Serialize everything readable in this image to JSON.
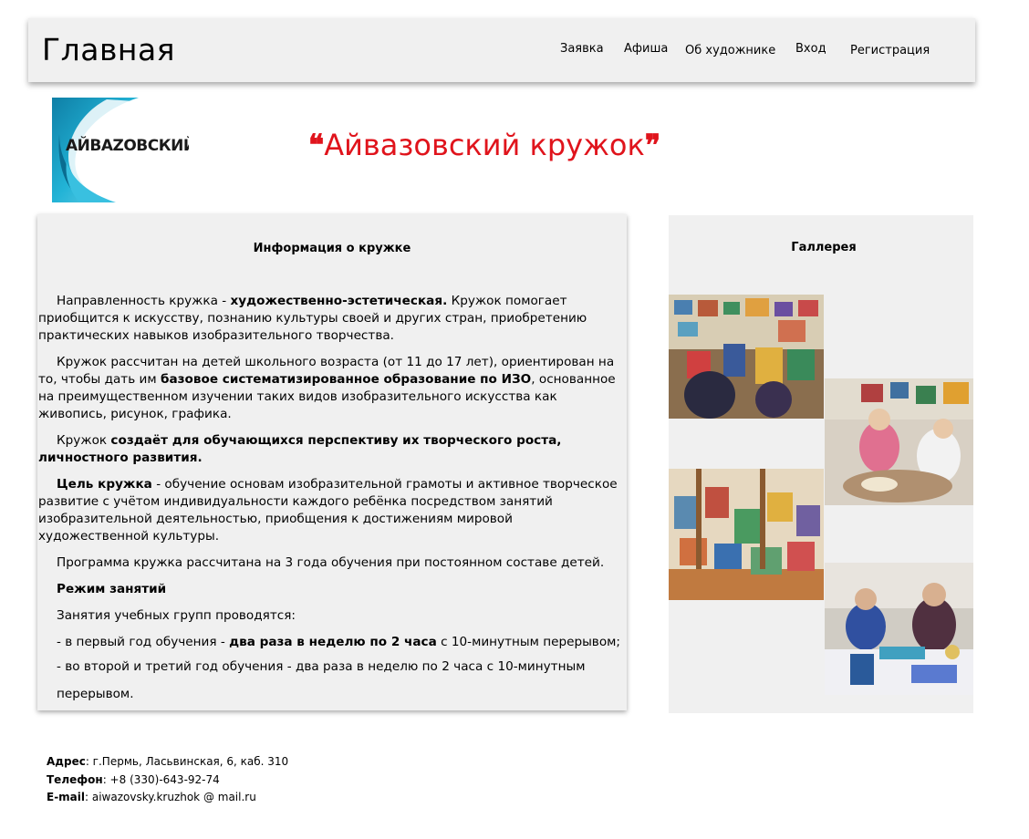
{
  "header": {
    "brand": "Главная",
    "nav": [
      "Заявка",
      "Афиша",
      "Об художнике",
      "Вход",
      "Регистрация"
    ]
  },
  "logo": {
    "text": "АЙВАZОВСКИЙ"
  },
  "title": {
    "open_quote": "❝",
    "text": "Айвазовский кружок",
    "close_quote": "❞"
  },
  "info": {
    "heading": "Информация о кружке",
    "p1": {
      "a": "Направленность кружка - ",
      "b": "художественно-эстетическая.",
      "c": " Кружок помогает приобщится к искусству, познанию культуры своей и других стран, приобретению практических навыков изобразительного творчества."
    },
    "p2": {
      "a": "Кружок рассчитан на детей школьного возраста (от 11 до 17 лет), ориентирован на то, чтобы дать им ",
      "b": "базовое систематизированное образование по ИЗО",
      "c": ", основанное на преимущественном изучении таких видов изобразительного искусства как живопись, рисунок, графика."
    },
    "p3": {
      "a": "Кружок ",
      "b": "создаёт для обучающихся перспективу их творческого роста, личностного развития."
    },
    "p4": {
      "b": "Цель кружка",
      "c": " - обучение основам изобразительной грамоты и активное творческое развитие с учётом индивидуальности каждого ребёнка посредством занятий изобразительной деятельностью, приобщения к достижениям мировой художественной культуры."
    },
    "p5": "Программа кружка рассчитана на 3 года обучения при постоянном составе детей.",
    "p6": "Режим занятий",
    "p7": "Занятия учебных групп проводятся:",
    "p8": {
      "a": "- в первый год обучения - ",
      "b": "два раза в неделю по 2 часа",
      "c": " с 10-минутным перерывом;"
    },
    "p9": "- во второй и третий год обучения - два раза в неделю по 2 часа с 10-минутным перерывом."
  },
  "gallery": {
    "heading": "Галлерея"
  },
  "footer": {
    "address_label": "Адрес",
    "address": ": г.Пермь, Ласьвинская, 6, каб. 310",
    "phone_label": "Телефон",
    "phone": ": +8 (330)-643-92-74",
    "email_label": "E-mail",
    "email": ": aiwazovsky.kruzhok @ mail.ru"
  },
  "colors": {
    "title": "#e0141c",
    "panel": "#f0f0f0",
    "logo_wave": "#1ea6c9"
  }
}
